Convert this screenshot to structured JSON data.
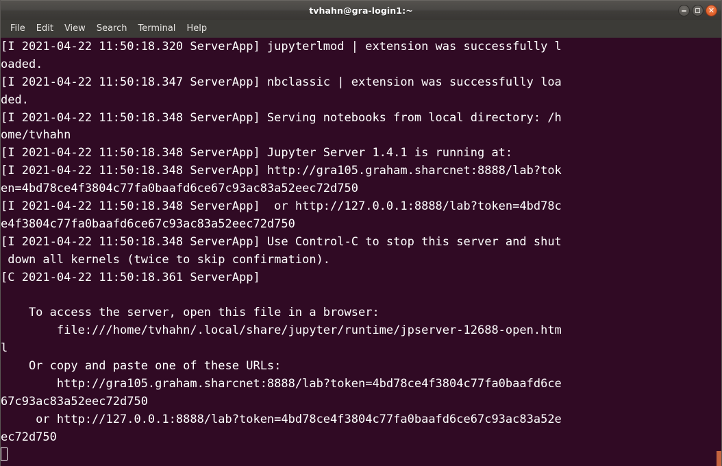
{
  "window": {
    "title": "tvhahn@gra-login1:~",
    "controls": [
      {
        "name": "minimize",
        "glyph": "–"
      },
      {
        "name": "maximize",
        "glyph": "□"
      },
      {
        "name": "close",
        "glyph": "✕"
      }
    ],
    "colors": {
      "terminal_background": "#300a24",
      "terminal_foreground": "#ffffff",
      "titlebar": "#4a4845",
      "menubar": "#3c3b37",
      "close_button": "#e4672f",
      "grip": "#c4633e"
    }
  },
  "menu": {
    "items": [
      {
        "label": "File"
      },
      {
        "label": "Edit"
      },
      {
        "label": "View"
      },
      {
        "label": "Search"
      },
      {
        "label": "Terminal"
      },
      {
        "label": "Help"
      }
    ]
  },
  "terminal": {
    "lines": [
      "[I 2021-04-22 11:50:18.320 ServerApp] jupyterlmod | extension was successfully l",
      "oaded.",
      "[I 2021-04-22 11:50:18.347 ServerApp] nbclassic | extension was successfully loa",
      "ded.",
      "[I 2021-04-22 11:50:18.348 ServerApp] Serving notebooks from local directory: /h",
      "ome/tvhahn",
      "[I 2021-04-22 11:50:18.348 ServerApp] Jupyter Server 1.4.1 is running at:",
      "[I 2021-04-22 11:50:18.348 ServerApp] http://gra105.graham.sharcnet:8888/lab?tok",
      "en=4bd78ce4f3804c77fa0baafd6ce67c93ac83a52eec72d750",
      "[I 2021-04-22 11:50:18.348 ServerApp]  or http://127.0.0.1:8888/lab?token=4bd78c",
      "e4f3804c77fa0baafd6ce67c93ac83a52eec72d750",
      "[I 2021-04-22 11:50:18.348 ServerApp] Use Control-C to stop this server and shut",
      " down all kernels (twice to skip confirmation).",
      "[C 2021-04-22 11:50:18.361 ServerApp]",
      "",
      "    To access the server, open this file in a browser:",
      "        file:///home/tvhahn/.local/share/jupyter/runtime/jpserver-12688-open.htm",
      "l",
      "    Or copy and paste one of these URLs:",
      "        http://gra105.graham.sharcnet:8888/lab?token=4bd78ce4f3804c77fa0baafd6ce",
      "67c93ac83a52eec72d750",
      "     or http://127.0.0.1:8888/lab?token=4bd78ce4f3804c77fa0baafd6ce67c93ac83a52e",
      "ec72d750"
    ],
    "cursor": {
      "shape": "hollow-block",
      "row": 23,
      "column": 1
    }
  }
}
